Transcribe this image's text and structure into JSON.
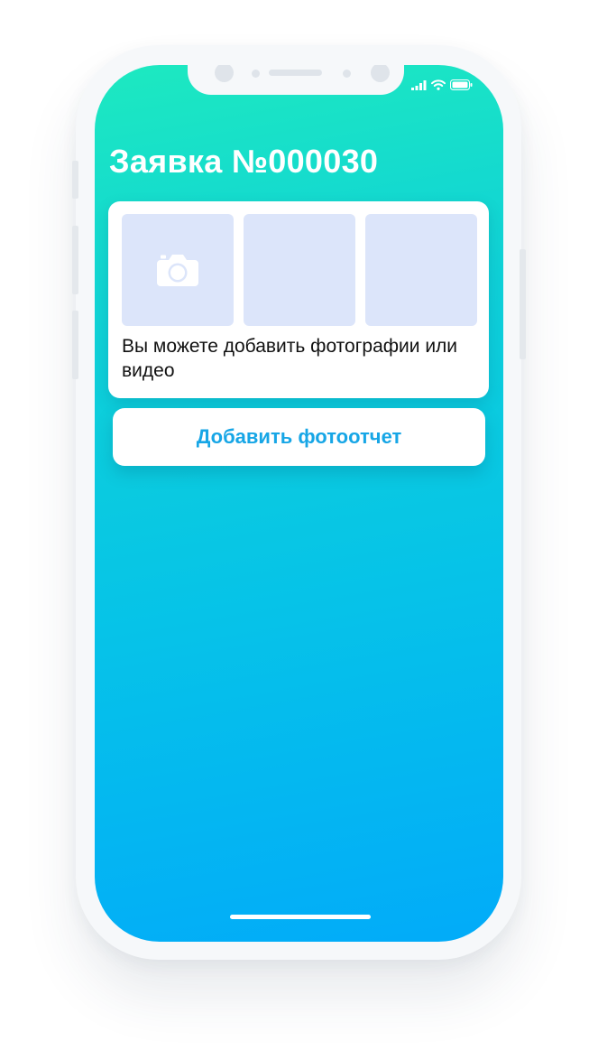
{
  "request": {
    "title": "Заявка №000030"
  },
  "photo_card": {
    "hint": "Вы можете добавить фотографии или видео",
    "slots": [
      {
        "icon": "camera-icon"
      },
      {
        "icon": ""
      },
      {
        "icon": ""
      }
    ]
  },
  "actions": {
    "add_photo_report_label": "Добавить фотоотчет"
  },
  "status_bar": {
    "icons": [
      "signal-icon",
      "wifi-icon",
      "battery-icon"
    ]
  },
  "colors": {
    "gradient_top": "#1de9c0",
    "gradient_bottom": "#02abf9",
    "slot_placeholder": "#dce5fa",
    "button_text": "#17a6e6"
  }
}
